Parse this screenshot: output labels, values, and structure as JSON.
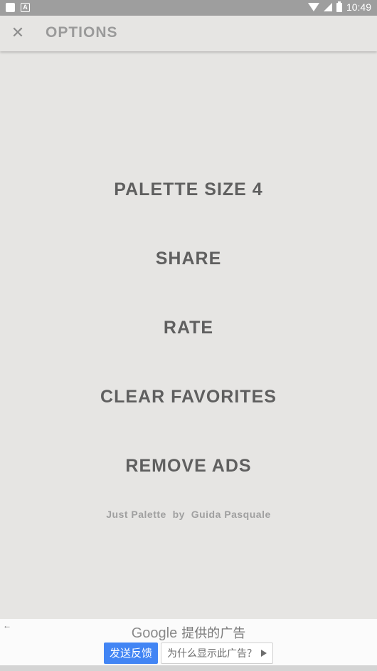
{
  "status_bar": {
    "time": "10:49",
    "left_icons": [
      "square-icon",
      "a-icon"
    ],
    "right_icons": [
      "wifi-icon",
      "cell-signal-icon",
      "battery-icon"
    ]
  },
  "toolbar": {
    "title": "OPTIONS",
    "close_icon": "close-icon"
  },
  "menu": {
    "items": [
      {
        "label": "PALETTE SIZE 4"
      },
      {
        "label": "SHARE"
      },
      {
        "label": "RATE"
      },
      {
        "label": "CLEAR FAVORITES"
      },
      {
        "label": "REMOVE ADS"
      }
    ],
    "credit": "Just Palette  by  Guida Pasquale"
  },
  "ad": {
    "back_icon": "back-arrow-icon",
    "provider": "Google",
    "title": "提供的广告",
    "feedback_label": "发送反馈",
    "why_label": "为什么显示此广告？"
  },
  "colors": {
    "background": "#e6e5e3",
    "menu_text": "#5f5f5f",
    "status_bar": "#9e9e9e",
    "ad_button": "#4285f4"
  }
}
